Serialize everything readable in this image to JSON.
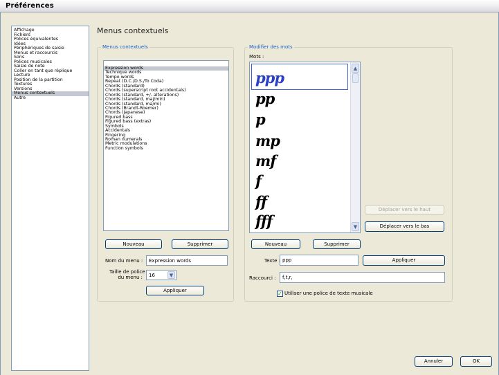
{
  "window": {
    "title": "Préférences"
  },
  "sidebar": {
    "items": [
      "Affichage",
      "Fichiers",
      "Polices équivalentes",
      "Idées",
      "Périphériques de saisie",
      "Menus et raccourcis",
      "Sons",
      "Polices musicales",
      "Saisie de note",
      "Coller en tant que réplique",
      "Lecture",
      "Position de la partition",
      "Textures",
      "Versions",
      "Menus contextuels",
      "Autre"
    ],
    "selected": "Menus contextuels"
  },
  "page": {
    "title": "Menus contextuels"
  },
  "menus_group": {
    "legend": "Menus contextuels",
    "items": [
      "Expression words",
      "Technique words",
      "Tempo words",
      "Repeat (D.C./D.S./To Coda)",
      "Chords (standard)",
      "Chords (superscript root accidentals)",
      "Chords (standard, +/- alterations)",
      "Chords (standard, maj/min)",
      "Chords (standard, ma/mi)",
      "Chords (Brandt-Roemer)",
      "Chords (Japanese)",
      "Figured bass",
      "Figured bass (extras)",
      "Symbols",
      "Accidentals",
      "Fingering",
      "Roman numerals",
      "Metric modulations",
      "Function symbols"
    ],
    "selected": "Expression words",
    "new_button": "Nouveau",
    "delete_button": "Supprimer",
    "menu_name_label": "Nom du menu :",
    "menu_name_value": "Expression words",
    "font_size_label_1": "Taille de police",
    "font_size_label_2": "du menu :",
    "font_size_value": "16",
    "apply_button": "Appliquer"
  },
  "words_group": {
    "legend": "Modifier des mots",
    "words_label": "Mots :",
    "words": [
      "ppp",
      "pp",
      "p",
      "mp",
      "mf",
      "f",
      "ff",
      "fff"
    ],
    "selected_word": "ppp",
    "move_up_button": "Déplacer vers le haut",
    "move_down_button": "Déplacer vers le bas",
    "new_button": "Nouveau",
    "delete_button": "Supprimer",
    "text_label": "Texte :",
    "text_value": "ppp",
    "apply_button": "Appliquer",
    "shortcut_label": "Raccourci :",
    "shortcut_value": "f,t,r,",
    "use_music_font_label": "Utiliser une police de texte musicale",
    "use_music_font_checked": true
  },
  "footer": {
    "cancel_button": "Annuler",
    "ok_button": "OK"
  },
  "colors": {
    "legend": "#1c5fc3",
    "selection": "#c5c8d0",
    "dialog_bg": "#ece9d8",
    "border": "#7f9db9"
  }
}
